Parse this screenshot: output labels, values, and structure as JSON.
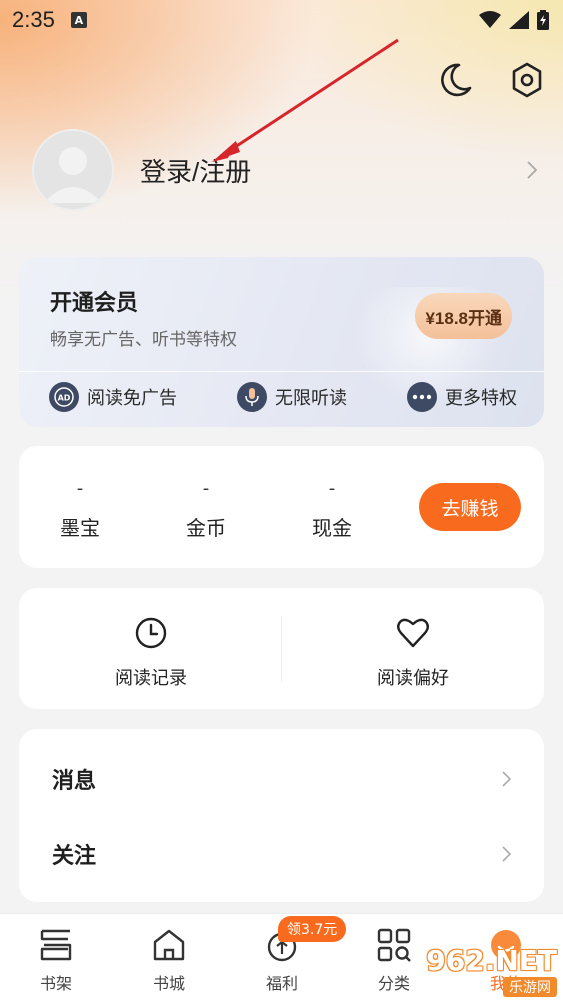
{
  "status_bar": {
    "time": "2:35",
    "notif_glyph": "A"
  },
  "profile": {
    "login_label": "登录/注册"
  },
  "vip": {
    "title": "开通会员",
    "subtitle": "畅享无广告、听书等特权",
    "price_button": "¥18.8开通",
    "perks": [
      {
        "label": "阅读免广告",
        "icon": "ad-icon",
        "icon_text": "AD"
      },
      {
        "label": "无限听读",
        "icon": "microphone-icon"
      },
      {
        "label": "更多特权",
        "icon": "more-dots-icon"
      }
    ]
  },
  "assets": {
    "items": [
      {
        "value": "-",
        "label": "墨宝"
      },
      {
        "value": "-",
        "label": "金币"
      },
      {
        "value": "-",
        "label": "现金"
      }
    ],
    "earn_button": "去赚钱"
  },
  "history": {
    "items": [
      {
        "label": "阅读记录",
        "icon": "clock-icon"
      },
      {
        "label": "阅读偏好",
        "icon": "heart-icon"
      }
    ]
  },
  "menu": {
    "items": [
      {
        "label": "消息"
      },
      {
        "label": "关注"
      }
    ]
  },
  "tab_bar": {
    "tabs": [
      {
        "label": "书架",
        "icon": "bookshelf-icon"
      },
      {
        "label": "书城",
        "icon": "home-icon"
      },
      {
        "label": "福利",
        "icon": "gift-icon"
      },
      {
        "label": "分类",
        "icon": "category-icon"
      },
      {
        "label": "我的",
        "icon": "smile-icon"
      }
    ],
    "welfare_badge": "领3.7元"
  },
  "watermark": {
    "big": "962.NET",
    "small": "乐游网"
  },
  "colors": {
    "accent": "#f86b1f",
    "vip_button": "#f4c09a",
    "background": "#f3f3f3"
  }
}
